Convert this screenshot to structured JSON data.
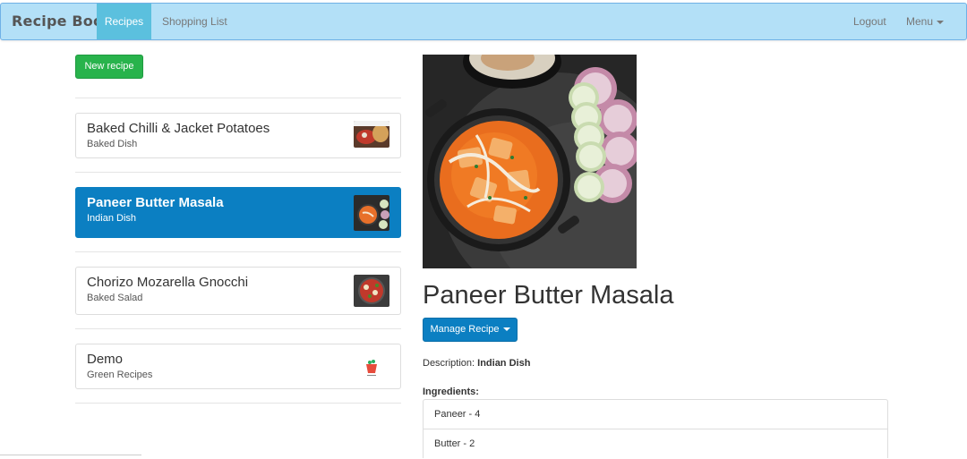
{
  "navbar": {
    "brand": "Recipe Book",
    "links": {
      "recipes": "Recipes",
      "shopping": "Shopping List"
    },
    "right": {
      "logout": "Logout",
      "menu": "Menu"
    }
  },
  "sidebar": {
    "new_button": "New recipe",
    "recipes": [
      {
        "name": "Baked Chilli & Jacket Potatoes",
        "description": "Baked Dish",
        "active": false
      },
      {
        "name": "Paneer Butter Masala",
        "description": "Indian Dish",
        "active": true
      },
      {
        "name": "Chorizo Mozarella Gnocchi",
        "description": "Baked Salad",
        "active": false
      },
      {
        "name": "Demo",
        "description": "Green Recipes",
        "active": false
      }
    ]
  },
  "detail": {
    "title": "Paneer Butter Masala",
    "manage_button": "Manage Recipe",
    "description_label": "Description:",
    "description_value": "Indian Dish",
    "ingredients_label": "Ingredients:",
    "ingredients": [
      "Paneer - 4",
      "Butter - 2"
    ]
  }
}
